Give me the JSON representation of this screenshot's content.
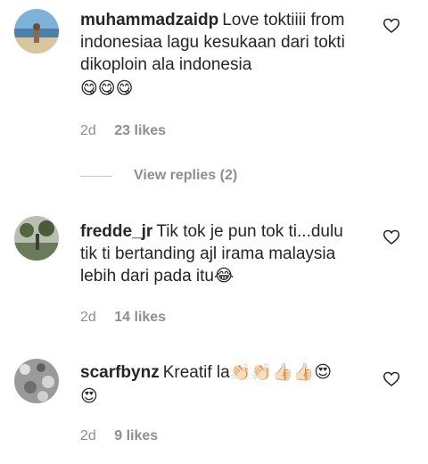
{
  "comments": [
    {
      "username": "muhammadzaidp",
      "text": "Love toktiiii from indonesiaa lagu kesukaan dari tokti dikoploin ala indonesia",
      "emojis": "😋😋😋",
      "time": "2d",
      "likes": "23 likes",
      "view_replies": "View replies (2)"
    },
    {
      "username": "fredde_jr",
      "text": "Tik tok je pun tok ti...dulu tik ti bertanding ajl irama malaysia lebih dari pada itu😂",
      "time": "2d",
      "likes": "14 likes"
    },
    {
      "username": "scarfbynz",
      "text": "Kreatif la👏🏻👏🏻👍🏻👍🏻😍",
      "emojis": "😍",
      "time": "2d",
      "likes": "9 likes"
    }
  ],
  "icons": {
    "like": "heart-outline-icon",
    "avatar": "avatar-photo"
  },
  "colors": {
    "text": "#262626",
    "meta": "#8e8e8e",
    "divider": "#c7c7c7"
  }
}
